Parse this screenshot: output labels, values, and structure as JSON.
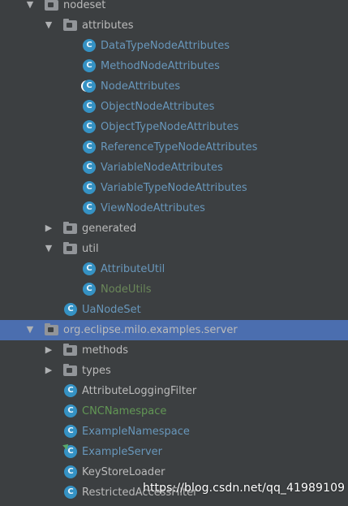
{
  "tree": {
    "nodes": [
      {
        "label": "nodeset",
        "kind": "folder",
        "state": "open",
        "tone": "default"
      },
      {
        "label": "attributes",
        "kind": "folder",
        "state": "open",
        "tone": "default"
      },
      {
        "label": "DataTypeNodeAttributes",
        "kind": "class",
        "tone": "blue"
      },
      {
        "label": "MethodNodeAttributes",
        "kind": "class",
        "tone": "blue"
      },
      {
        "label": "NodeAttributes",
        "kind": "class",
        "tone": "blue"
      },
      {
        "label": "ObjectNodeAttributes",
        "kind": "class",
        "tone": "blue"
      },
      {
        "label": "ObjectTypeNodeAttributes",
        "kind": "class",
        "tone": "blue"
      },
      {
        "label": "ReferenceTypeNodeAttributes",
        "kind": "class",
        "tone": "blue"
      },
      {
        "label": "VariableNodeAttributes",
        "kind": "class",
        "tone": "blue"
      },
      {
        "label": "VariableTypeNodeAttributes",
        "kind": "class",
        "tone": "blue"
      },
      {
        "label": "ViewNodeAttributes",
        "kind": "class",
        "tone": "blue"
      },
      {
        "label": "generated",
        "kind": "folder",
        "state": "closed",
        "tone": "default"
      },
      {
        "label": "util",
        "kind": "folder",
        "state": "open",
        "tone": "default"
      },
      {
        "label": "AttributeUtil",
        "kind": "class",
        "tone": "blue"
      },
      {
        "label": "NodeUtils",
        "kind": "class",
        "tone": "green"
      },
      {
        "label": "UaNodeSet",
        "kind": "class",
        "tone": "blue"
      },
      {
        "label": "org.eclipse.milo.examples.server",
        "kind": "folder",
        "state": "open",
        "tone": "default",
        "selected": true
      },
      {
        "label": "methods",
        "kind": "folder",
        "state": "closed",
        "tone": "default"
      },
      {
        "label": "types",
        "kind": "folder",
        "state": "closed",
        "tone": "default"
      },
      {
        "label": "AttributeLoggingFilter",
        "kind": "class",
        "tone": "default"
      },
      {
        "label": "CNCNamespace",
        "kind": "class",
        "tone": "green"
      },
      {
        "label": "ExampleNamespace",
        "kind": "class",
        "tone": "blue"
      },
      {
        "label": "ExampleServer",
        "kind": "class",
        "tone": "blue",
        "main": true
      },
      {
        "label": "KeyStoreLoader",
        "kind": "class",
        "tone": "default"
      },
      {
        "label": "RestrictedAccessFilter",
        "kind": "class",
        "tone": "default"
      }
    ]
  },
  "icons": {
    "class_letter": "C",
    "arrow_open": "▼",
    "arrow_closed": "▶"
  },
  "watermark": "https://blog.csdn.net/qq_41989109",
  "colors": {
    "background": "#3c3f41",
    "selection": "#4b6eaf",
    "text_default": "#bbbbbb",
    "text_blue": "#6897bb",
    "text_green": "#6a8759",
    "class_icon": "#3592c4"
  }
}
